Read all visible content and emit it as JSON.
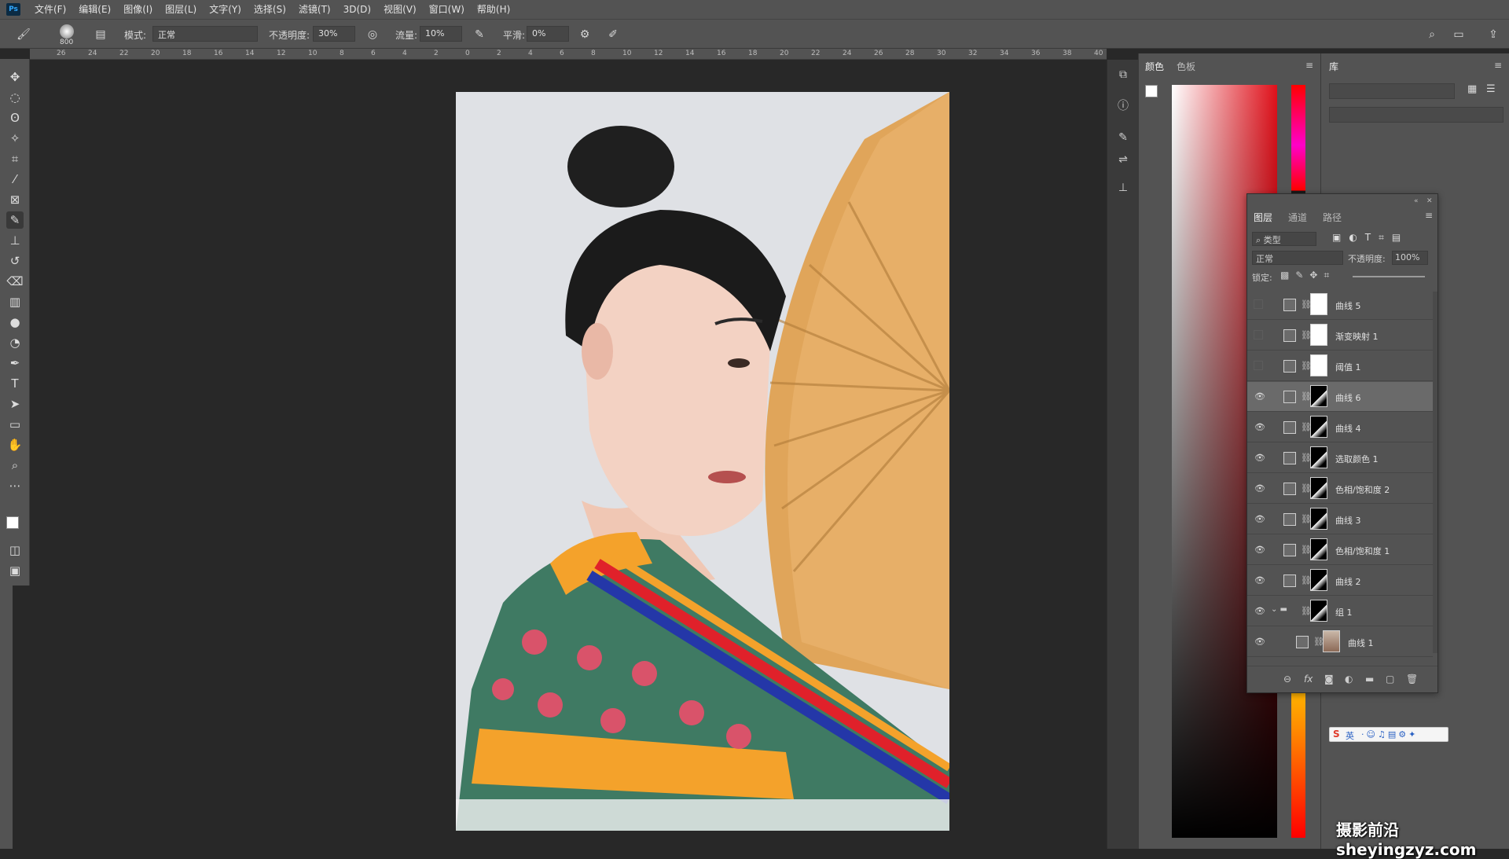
{
  "app": {
    "logo": "Ps"
  },
  "menu": [
    "文件(F)",
    "编辑(E)",
    "图像(I)",
    "图层(L)",
    "文字(Y)",
    "选择(S)",
    "滤镜(T)",
    "3D(D)",
    "视图(V)",
    "窗口(W)",
    "帮助(H)"
  ],
  "options": {
    "brush_size": "800",
    "mode_label": "模式:",
    "mode_value": "正常",
    "opacity_label": "不透明度:",
    "opacity_value": "30%",
    "flow_label": "流量:",
    "flow_value": "10%",
    "smoothing_label": "平滑:",
    "smoothing_value": "0%"
  },
  "ruler": {
    "top": [
      "26",
      "24",
      "22",
      "20",
      "18",
      "16",
      "14",
      "12",
      "10",
      "8",
      "6",
      "4",
      "2",
      "0",
      "2",
      "4",
      "6",
      "8",
      "10",
      "12",
      "14",
      "16",
      "18",
      "20",
      "22",
      "24",
      "26",
      "28",
      "30",
      "32",
      "34",
      "36",
      "38",
      "40"
    ]
  },
  "color_panel": {
    "tabs": [
      "颜色",
      "色板"
    ]
  },
  "library_panel": {
    "tab": "库"
  },
  "layers_panel": {
    "tabs": [
      "图层",
      "通道",
      "路径"
    ],
    "filter_label": "类型",
    "blend_mode": "正常",
    "opacity_label": "不透明度:",
    "opacity_value": "100%",
    "lock_label": "锁定:",
    "layers": [
      {
        "name": "曲线 5",
        "visible": false,
        "mask": "white"
      },
      {
        "name": "渐变映射 1",
        "visible": false,
        "mask": "white"
      },
      {
        "name": "阈值 1",
        "visible": false,
        "mask": "white"
      },
      {
        "name": "曲线 6",
        "visible": true,
        "mask": "dark",
        "selected": true
      },
      {
        "name": "曲线 4",
        "visible": true,
        "mask": "dark"
      },
      {
        "name": "选取颜色 1",
        "visible": true,
        "mask": "dark"
      },
      {
        "name": "色相/饱和度 2",
        "visible": true,
        "mask": "dark"
      },
      {
        "name": "曲线 3",
        "visible": true,
        "mask": "dark"
      },
      {
        "name": "色相/饱和度 1",
        "visible": true,
        "mask": "dark"
      },
      {
        "name": "曲线 2",
        "visible": true,
        "mask": "dark"
      },
      {
        "name": "组 1",
        "visible": true,
        "mask": "dark",
        "group": true
      },
      {
        "name": "曲线 1",
        "visible": true,
        "mask": "photo",
        "indent": true
      }
    ]
  },
  "ime": {
    "label": "英"
  },
  "watermark": "摄影前沿 sheyingzyz.com"
}
